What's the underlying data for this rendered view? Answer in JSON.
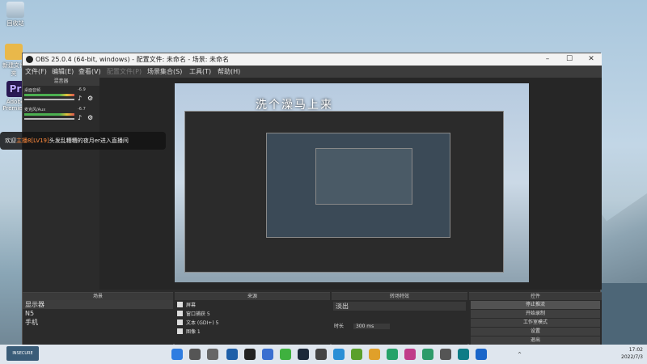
{
  "desktop": {
    "icons": [
      {
        "label": "回收站",
        "icon": "recycle-bin-icon"
      },
      {
        "label": "新建文件夹",
        "icon": "folder-icon"
      },
      {
        "label": "Adobe Premiere",
        "icon": "premiere-icon"
      }
    ]
  },
  "obs": {
    "title": "OBS 25.0.4 (64-bit, windows) - 配置文件: 未命名 - 场景: 未命名",
    "menu": [
      "文件(F)",
      "编辑(E)",
      "查看(V)",
      "配置文件(P)",
      "场景集合(S)",
      "工具(T)",
      "帮助(H)"
    ],
    "mixer": {
      "header": "混音器",
      "channels": [
        {
          "name": "桌面音频",
          "db": "-6.9"
        },
        {
          "name": "麦克风/Aux",
          "db": "-6.7"
        }
      ]
    },
    "preview": {
      "overlay_text": "洗个澡马上来"
    },
    "scenes": {
      "header": "场景",
      "items": [
        "显示器",
        "N5",
        "手机"
      ]
    },
    "sources": {
      "header": "来源",
      "items": [
        "屏幕",
        "窗口捕获 5",
        "文本 (GDI+) 5",
        "图像 1"
      ]
    },
    "transitions": {
      "header": "转场特效",
      "type": "淡出",
      "duration_label": "时长",
      "duration_value": "300 ms"
    },
    "controls": {
      "header": "控件",
      "buttons": [
        "停止推流",
        "开始录制",
        "工作室模式",
        "设置",
        "退出"
      ]
    }
  },
  "chat": {
    "prefix": "欢迎",
    "user": "主播8[LV19]",
    "suffix": "头发乱糟糟的夜月er进入直播间"
  },
  "taskbar": {
    "time": "17:02",
    "date": "2022/7/3",
    "widget": "INSECURE"
  }
}
